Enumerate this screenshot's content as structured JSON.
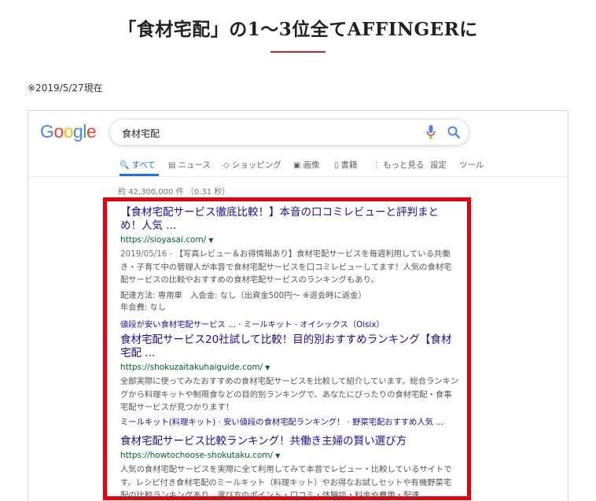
{
  "heading": "「食材宅配」の1〜3位全てAFFINGERに",
  "note": "※2019/5/27現在",
  "google": {
    "logo_letters": [
      {
        "ch": "G",
        "color": "#4285F4"
      },
      {
        "ch": "o",
        "color": "#EA4335"
      },
      {
        "ch": "o",
        "color": "#FBBC05"
      },
      {
        "ch": "g",
        "color": "#4285F4"
      },
      {
        "ch": "l",
        "color": "#34A853"
      },
      {
        "ch": "e",
        "color": "#EA4335"
      }
    ],
    "query": "食材宅配",
    "tabs": [
      {
        "icon": "🔍",
        "label": "すべて",
        "active": true
      },
      {
        "icon": "▤",
        "label": "ニュース"
      },
      {
        "icon": "◇",
        "label": "ショッピング"
      },
      {
        "icon": "▣",
        "label": "画像"
      },
      {
        "icon": "▯",
        "label": "書籍"
      },
      {
        "icon": "⋮",
        "label": "もっと見る"
      },
      {
        "icon": "",
        "label": "設定"
      },
      {
        "icon": "",
        "label": "ツール"
      }
    ],
    "stats": "約 42,300,000 件 （0.31 秒）",
    "results": [
      {
        "title": "【食材宅配サービス徹底比較！】本音の口コミレビューと評判まとめ！人気 ...",
        "url": "https://sioyasai.com/",
        "date": "2019/05/16 - ",
        "snippet": "【写真レビュー＆お得情報あり】食材宅配サービスを毎週利用している共働き・子育て中の管理人が本音で食材宅配サービスを口コミレビューしてます！人気の食材宅配サービスの比較やおすすめの食材宅配サービスのランキングもあり。",
        "meta1": "配達方法: 専用車　入会金: なし（出資金500円〜 ※退会時に返金）",
        "meta2": "年会費: なし",
        "sitelinks": "値段が安い食材宅配サービス ... · ミールキット · オイシックス（Oisix）"
      },
      {
        "title": "食材宅配サービス20社試して比較！目的別おすすめランキング【食材宅配 ...",
        "url": "https://shokuzaitakuhaiguide.com/",
        "snippet": "全部実際に使ってみたおすすめの食材宅配サービスを比較して紹介しています。総合ランキングから料理キットや制限食などの目的別ランキングで、あなたにぴったりの食材宅配・食事宅配サービスが見つかります！",
        "sitelinks": "ミールキット(料理キット) · 安い値段の食材宅配ランキング！ · 野菜宅配おすすめ人気 ..."
      },
      {
        "title": "食材宅配サービス比較ランキング！共働き主婦の賢い選び方",
        "url": "https://howtochoose-shokutaku.com/",
        "snippet": "人気の食材宅配サービスを実際に全て利用してみて本音でレビュー・比較しているサイトです。レシピ付き食材宅配のミールキット（料理キット）やお得なお試しセットや有機野菜宅配の比較ランキングあり。選び方のポイント・口コミ・体験談・料金や費用・配達 ..."
      }
    ],
    "highlight_color": "#e8000b",
    "accent_color": "#c0272d"
  }
}
